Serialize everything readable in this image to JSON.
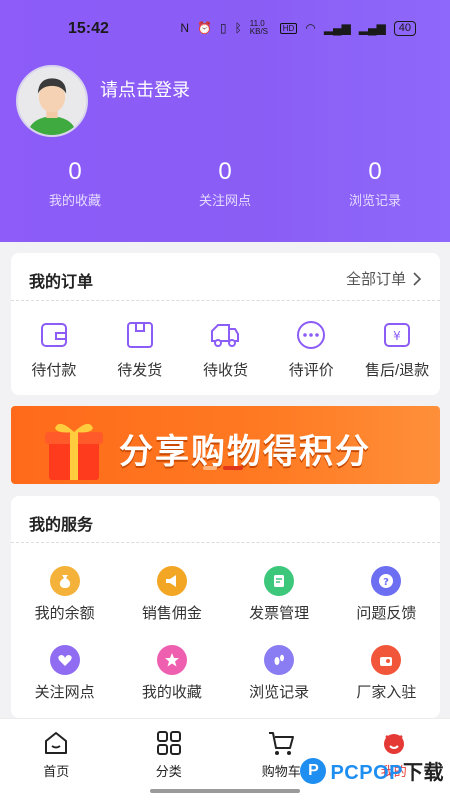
{
  "status_bar": {
    "time": "15:42",
    "network_speed": "11.0 KB/S",
    "battery": "40"
  },
  "profile": {
    "login_prompt": "请点击登录"
  },
  "stats": [
    {
      "count": "0",
      "label": "我的收藏"
    },
    {
      "count": "0",
      "label": "关注网点"
    },
    {
      "count": "0",
      "label": "浏览记录"
    }
  ],
  "orders": {
    "title": "我的订单",
    "all_link": "全部订单",
    "items": [
      {
        "label": "待付款",
        "icon": "wallet-icon"
      },
      {
        "label": "待发货",
        "icon": "box-icon"
      },
      {
        "label": "待收货",
        "icon": "truck-icon"
      },
      {
        "label": "待评价",
        "icon": "comment-icon"
      },
      {
        "label": "售后/退款",
        "icon": "refund-icon"
      }
    ]
  },
  "banner": {
    "text": "分享购物得积分"
  },
  "services": {
    "title": "我的服务",
    "items": [
      {
        "label": "我的余额",
        "icon": "money-bag-icon",
        "color": "#f5b23a"
      },
      {
        "label": "销售佣金",
        "icon": "megaphone-icon",
        "color": "#f2a623"
      },
      {
        "label": "发票管理",
        "icon": "invoice-icon",
        "color": "#3dc77a"
      },
      {
        "label": "问题反馈",
        "icon": "question-icon",
        "color": "#6d6ff2"
      },
      {
        "label": "关注网点",
        "icon": "heart-icon",
        "color": "#8f6cf2"
      },
      {
        "label": "我的收藏",
        "icon": "star-icon",
        "color": "#ee5fb0"
      },
      {
        "label": "浏览记录",
        "icon": "footprint-icon",
        "color": "#8a7cf3"
      },
      {
        "label": "厂家入驻",
        "icon": "factory-icon",
        "color": "#f2563a"
      }
    ]
  },
  "tabbar": [
    {
      "label": "首页",
      "icon": "home-icon"
    },
    {
      "label": "分类",
      "icon": "grid-icon"
    },
    {
      "label": "购物车",
      "icon": "cart-icon"
    },
    {
      "label": "我的",
      "icon": "profile-icon"
    }
  ],
  "watermark": {
    "brand": "PCPOP",
    "suffix": "下载"
  },
  "colors": {
    "accent": "#8d5cf9",
    "active_tab": "#e53935",
    "banner": "#ff6a1a"
  }
}
